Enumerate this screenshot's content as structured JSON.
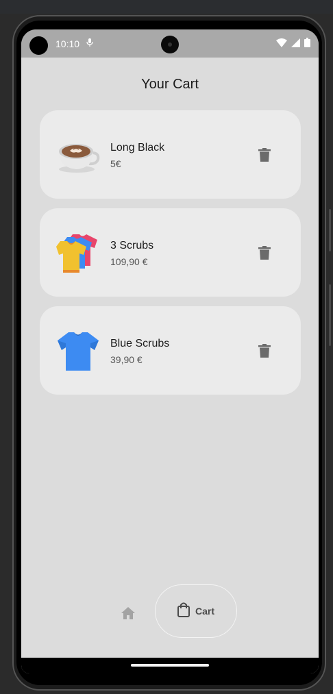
{
  "status_bar": {
    "time": "10:10"
  },
  "page": {
    "title": "Your Cart"
  },
  "cart_items": [
    {
      "name": "Long Black",
      "price": "5€",
      "icon": "coffee-cup-icon"
    },
    {
      "name": "3 Scrubs",
      "price": "109,90 €",
      "icon": "stacked-shirts-icon"
    },
    {
      "name": "Blue Scrubs",
      "price": "39,90 €",
      "icon": "blue-shirt-icon"
    }
  ],
  "bottom_nav": {
    "home_icon": "home-icon",
    "cart_label": "Cart",
    "cart_icon": "shopping-bag-icon"
  },
  "colors": {
    "screen_bg": "#dcdcdc",
    "card_bg": "#ebebeb",
    "status_bar_bg": "#a9a9a9",
    "delete_icon": "#6b6b6b",
    "blue_shirt": "#3d8bf2"
  }
}
